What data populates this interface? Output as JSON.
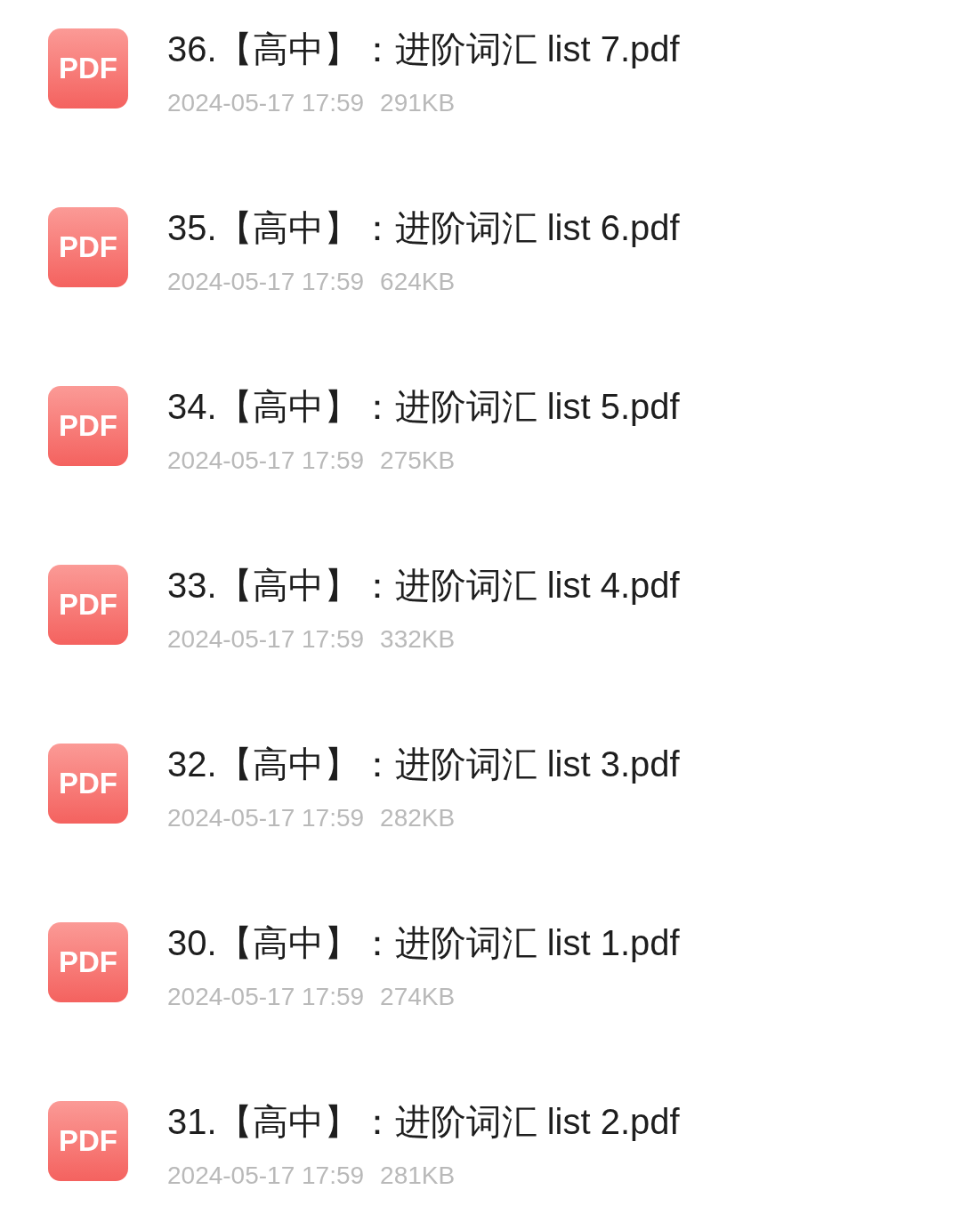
{
  "files": [
    {
      "icon_label": "PDF",
      "name": "36.【高中】：进阶词汇 list 7.pdf",
      "date": "2024-05-17 17:59",
      "size": "291KB"
    },
    {
      "icon_label": "PDF",
      "name": "35.【高中】：进阶词汇 list 6.pdf",
      "date": "2024-05-17 17:59",
      "size": "624KB"
    },
    {
      "icon_label": "PDF",
      "name": "34.【高中】：进阶词汇 list 5.pdf",
      "date": "2024-05-17 17:59",
      "size": "275KB"
    },
    {
      "icon_label": "PDF",
      "name": "33.【高中】：进阶词汇 list 4.pdf",
      "date": "2024-05-17 17:59",
      "size": "332KB"
    },
    {
      "icon_label": "PDF",
      "name": "32.【高中】：进阶词汇 list 3.pdf",
      "date": "2024-05-17 17:59",
      "size": "282KB"
    },
    {
      "icon_label": "PDF",
      "name": "30.【高中】：进阶词汇 list 1.pdf",
      "date": "2024-05-17 17:59",
      "size": "274KB"
    },
    {
      "icon_label": "PDF",
      "name": "31.【高中】：进阶词汇 list 2.pdf",
      "date": "2024-05-17 17:59",
      "size": "281KB"
    }
  ]
}
